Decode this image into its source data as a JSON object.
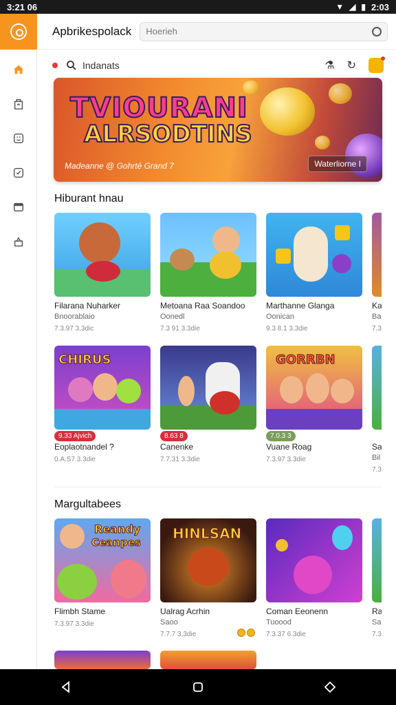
{
  "status": {
    "time": "3:21 06",
    "battery_time": "2:03"
  },
  "header": {
    "title": "Apbrikespolack",
    "search_placeholder": "Hoerieh"
  },
  "subbar": {
    "search_text": "Indanats"
  },
  "hero": {
    "title_line1": "TVIOURANI",
    "title_line2": "ALRSODTINS",
    "subtitle": "Madeanne @ Gohrté Grand 7",
    "chip": "Waterliorne I"
  },
  "sections": [
    {
      "title": "Hiburant hnau",
      "rows": [
        [
          {
            "name": "Filarana Nuharker",
            "meta1": "Bnoorablaio",
            "meta2": "7.3.97 3.3dic",
            "badge": ""
          },
          {
            "name": "Metoana Raa Soandoo",
            "meta1": "Oonedl",
            "meta2": "7.3 91 3.3die",
            "badge": ""
          },
          {
            "name": "Marthanne Glanga",
            "meta1": "Oonican",
            "meta2": "9.3 8.1 3.3die",
            "badge": ""
          },
          {
            "name": "Ka",
            "meta1": "Ba",
            "meta2": "7.3",
            "badge": ""
          }
        ],
        [
          {
            "name": "Eoplaotnandel ?",
            "meta1": "",
            "meta2": "0.A.S7 3.3die",
            "badge": "9.33 Ajvich"
          },
          {
            "name": "Canenke",
            "meta1": "",
            "meta2": "7.7.31 3.3die",
            "badge": "8.63 8"
          },
          {
            "name": "Vuane Roag",
            "meta1": "",
            "meta2": "7.3.97 3.3die",
            "badge": "7.0.3 3"
          },
          {
            "name": "Sa",
            "meta1": "Bil",
            "meta2": "7.3",
            "badge": ""
          }
        ]
      ]
    },
    {
      "title": "Margultabees",
      "rows": [
        [
          {
            "name": "Flimbh Stame",
            "meta1": "",
            "meta2": "7.3.97 3.3die",
            "badge": ""
          },
          {
            "name": "Ualrag Acrhin",
            "meta1": "Saoo",
            "meta2": "7.7.7 3.3die",
            "badge": ""
          },
          {
            "name": "Coman Eeonenn",
            "meta1": "Tuoood",
            "meta2": "7.3.37 6.3die",
            "badge": ""
          },
          {
            "name": "Ra",
            "meta1": "Sa",
            "meta2": "7.3",
            "badge": ""
          }
        ]
      ]
    }
  ],
  "art_text": {
    "card_b1": "CHIRUS",
    "card_b3": "GORRBN",
    "card_c1_top": "Reandy",
    "card_c1_bot": "Ceanpes",
    "card_c2": "HINLSAN"
  },
  "colors": {
    "accent": "#f7941d",
    "badge_red": "#d6303b",
    "badge_green": "#7a9e5a"
  },
  "icons": [
    "home-icon",
    "bag-icon",
    "face-icon",
    "check-icon",
    "folder-icon",
    "share-icon"
  ]
}
